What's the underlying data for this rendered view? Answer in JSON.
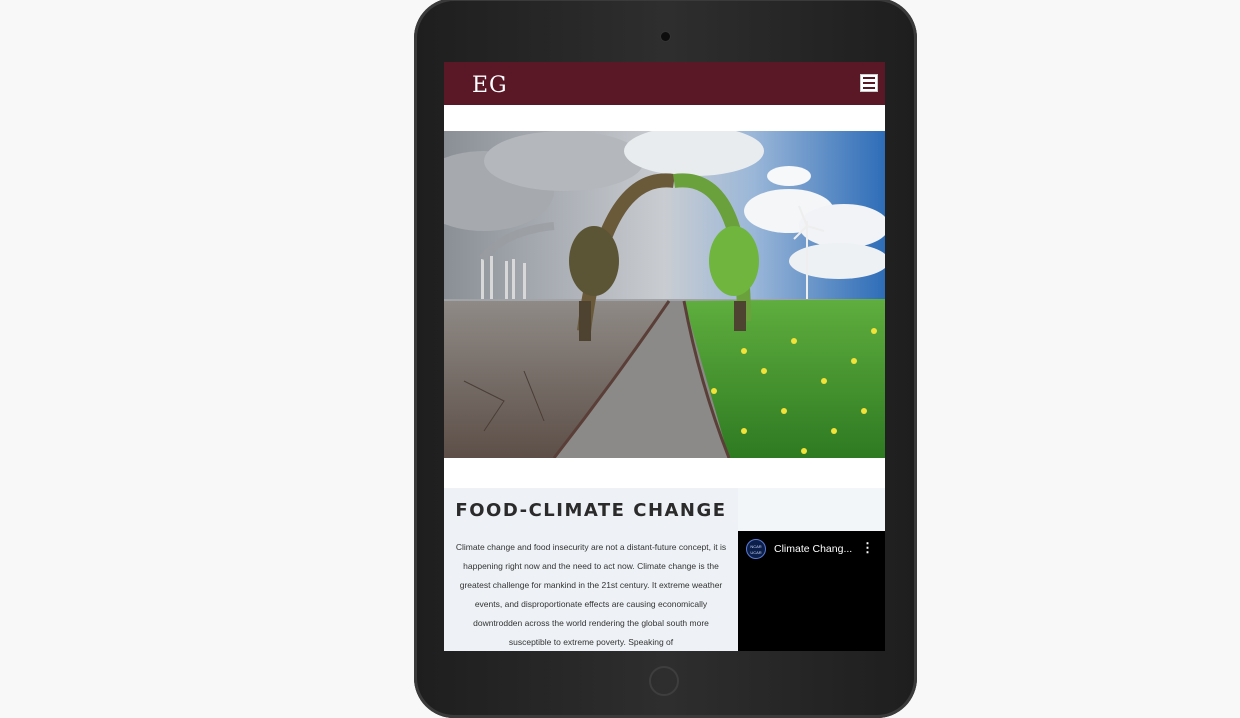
{
  "site": {
    "logo": "EG",
    "menu_icon": "hamburger-menu-icon"
  },
  "hero": {
    "description_icon": "climate-contrast-image"
  },
  "article": {
    "title": "FOOD-CLIMATE CHANGE",
    "body": "Climate change and food insecurity are not a distant-future concept, it is happening right now and the need to act now. Climate change is the greatest challenge for mankind in the 21st century. It extreme weather events, and disproportionate effects are causing economically downtrodden across the world rendering the global south more susceptible to extreme poverty. Speaking of"
  },
  "video": {
    "channel_logo": "NCAR UCAR",
    "title": "Climate Chang...",
    "more_icon": "more-vertical-icon"
  },
  "colors": {
    "nav_bg": "#5a1726",
    "content_bg": "#eef2f6",
    "video_bg": "#000000"
  }
}
